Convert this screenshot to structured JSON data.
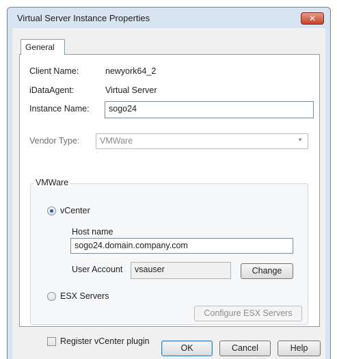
{
  "window": {
    "title": "Virtual Server Instance Properties",
    "close_icon": "close-icon"
  },
  "tabs": [
    {
      "label": "General"
    }
  ],
  "general": {
    "client_name_label": "Client Name:",
    "client_name_value": "newyork64_2",
    "idataagent_label": "iDataAgent:",
    "idataagent_value": "Virtual Server",
    "instance_name_label": "Instance Name:",
    "instance_name_value": "sogo24",
    "vendor_type_label": "Vendor Type:",
    "vendor_type_value": "VMWare"
  },
  "vmware": {
    "group_title": "VMWare",
    "vcenter_label": "vCenter",
    "vcenter_selected": true,
    "host_name_label": "Host name",
    "host_name_value": "sogo24.domain.company.com",
    "user_account_label": "User Account",
    "user_account_value": "vsauser",
    "change_button": "Change",
    "esx_servers_label": "ESX Servers",
    "configure_esx_button": "Configure ESX Servers",
    "register_plugin_label": "Register vCenter plugin",
    "register_plugin_checked": false
  },
  "footer": {
    "ok": "OK",
    "cancel": "Cancel",
    "help": "Help"
  },
  "colors": {
    "accent": "#2a5fa8",
    "window_frame": "#d8e4f1",
    "close_button": "#c7432b"
  }
}
